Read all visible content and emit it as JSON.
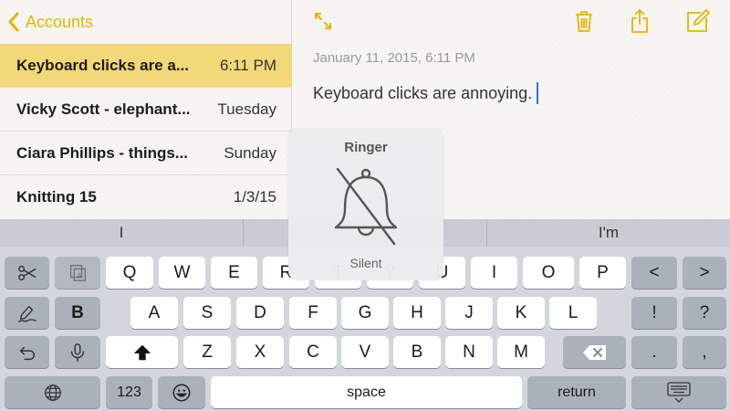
{
  "colors": {
    "accent": "#e8b400",
    "selected_row": "#f2d876",
    "caret": "#2a6df4"
  },
  "sidebar": {
    "back_label": "Accounts",
    "notes": [
      {
        "title": "Keyboard clicks are a...",
        "date": "6:11 PM",
        "selected": true
      },
      {
        "title": "Vicky Scott - elephant...",
        "date": "Tuesday",
        "selected": false
      },
      {
        "title": "Ciara Phillips - things...",
        "date": "Sunday",
        "selected": false
      },
      {
        "title": "Knitting 15",
        "date": "1/3/15",
        "selected": false
      }
    ]
  },
  "toolbar": {
    "icons": [
      "expand-icon",
      "trash-icon",
      "share-icon",
      "compose-icon"
    ]
  },
  "note": {
    "timestamp": "January 11, 2015, 6:11 PM",
    "body": "Keyboard clicks are annoying."
  },
  "keyboard": {
    "suggestions": [
      "I",
      "",
      "I'm"
    ],
    "row1": [
      "Q",
      "W",
      "E",
      "R",
      "T",
      "Y",
      "U",
      "I",
      "O",
      "P"
    ],
    "row2": [
      "A",
      "S",
      "D",
      "F",
      "G",
      "H",
      "J",
      "K",
      "L"
    ],
    "row3": [
      "Z",
      "X",
      "C",
      "V",
      "B",
      "N",
      "M"
    ],
    "bold_label": "B",
    "numbers_label": "123",
    "space_label": "space",
    "return_label": "return",
    "row1_right": [
      "<",
      ">"
    ],
    "row2_right": [
      "!",
      "?"
    ],
    "row3_right": [
      ".",
      ","
    ]
  },
  "ringer": {
    "title": "Ringer",
    "state": "Silent",
    "icon": "bell-slash-icon"
  }
}
